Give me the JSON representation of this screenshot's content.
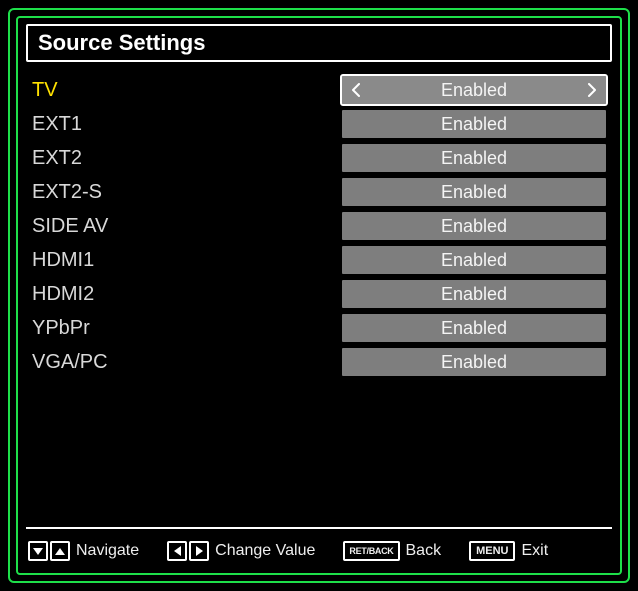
{
  "title": "Source Settings",
  "selected_index": 0,
  "sources": [
    {
      "label": "TV",
      "value": "Enabled"
    },
    {
      "label": "EXT1",
      "value": "Enabled"
    },
    {
      "label": "EXT2",
      "value": "Enabled"
    },
    {
      "label": "EXT2-S",
      "value": "Enabled"
    },
    {
      "label": "SIDE AV",
      "value": "Enabled"
    },
    {
      "label": "HDMI1",
      "value": "Enabled"
    },
    {
      "label": "HDMI2",
      "value": "Enabled"
    },
    {
      "label": "YPbPr",
      "value": "Enabled"
    },
    {
      "label": "VGA/PC",
      "value": "Enabled"
    }
  ],
  "hints": {
    "navigate": "Navigate",
    "change_value": "Change Value",
    "back_key": "RET/BACK",
    "back": "Back",
    "exit_key": "MENU",
    "exit": "Exit"
  }
}
